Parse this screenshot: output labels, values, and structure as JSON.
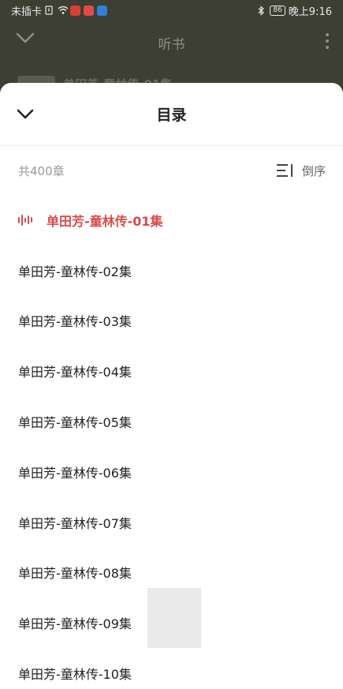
{
  "status_bar": {
    "carrier": "未插卡",
    "battery": "86",
    "time": "晚上9:16"
  },
  "background_player": {
    "title": "听书",
    "track_title": "单田芳-童林传-01集"
  },
  "sheet": {
    "title": "目录",
    "chapter_count": "共400章",
    "sort_label": "倒序",
    "items": [
      {
        "label": "单田芳-童林传-01集",
        "active": true
      },
      {
        "label": "单田芳-童林传-02集"
      },
      {
        "label": "单田芳-童林传-03集"
      },
      {
        "label": "单田芳-童林传-04集"
      },
      {
        "label": "单田芳-童林传-05集"
      },
      {
        "label": "单田芳-童林传-06集"
      },
      {
        "label": "单田芳-童林传-07集"
      },
      {
        "label": "单田芳-童林传-08集"
      },
      {
        "label": "单田芳-童林传-09集"
      },
      {
        "label": "单田芳-童林传-10集"
      }
    ]
  },
  "colors": {
    "accent": "#d94a4a",
    "backdrop": "#3d3f33"
  },
  "icons": [
    "chevron-down-icon",
    "sort-icon",
    "playing-icon",
    "more-icon",
    "wifi-icon",
    "bluetooth-icon"
  ]
}
